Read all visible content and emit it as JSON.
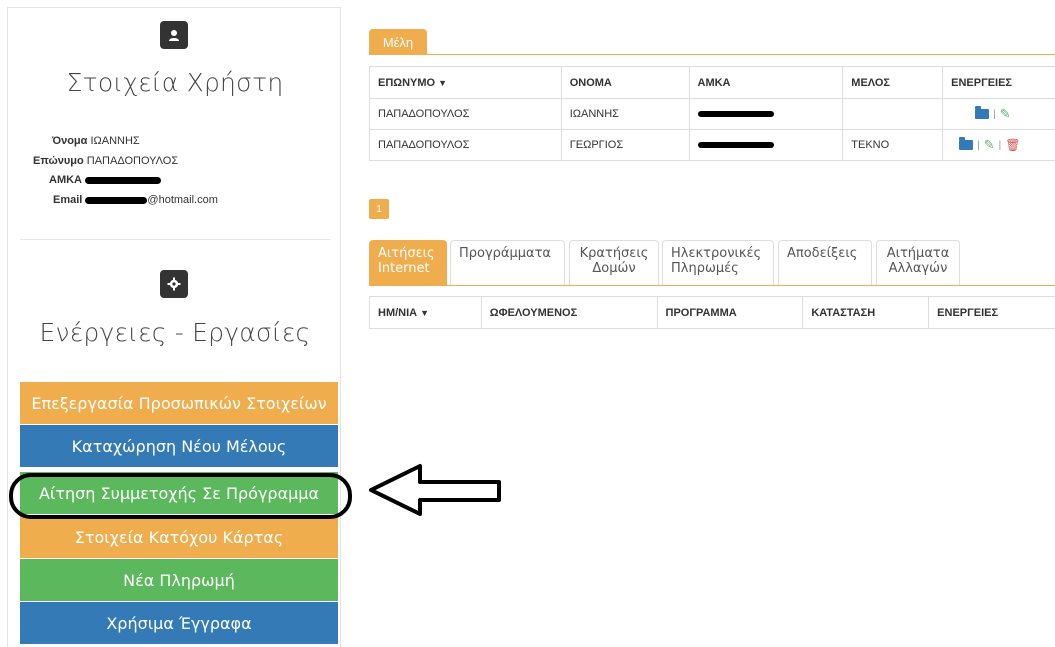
{
  "user_panel": {
    "title": "Στοιχεία Χρήστη",
    "name_label": "Όνομα",
    "name_value": "ΙΩΑΝΝΗΣ",
    "surname_label": "Επώνυμο",
    "surname_value": "ΠΑΠΑΔΟΠΟΥΛΟΣ",
    "amka_label": "ΑΜΚΑ",
    "email_label": "Email",
    "email_suffix": "@hotmail.com"
  },
  "actions_panel": {
    "title": "Ενέργειες - Εργασίες",
    "buttons": [
      {
        "label": "Επεξεργασία Προσωπικών Στοιχείων",
        "color": "#f0ad4e"
      },
      {
        "label": "Καταχώρηση Νέου Μέλους",
        "color": "#337ab7"
      },
      {
        "label": "Αίτηση Συμμετοχής Σε Πρόγραμμα",
        "color": "#5cb85c"
      },
      {
        "label": "Στοιχεία Κατόχου Κάρτας",
        "color": "#f0ad4e"
      },
      {
        "label": "Νέα Πληρωμή",
        "color": "#5cb85c"
      },
      {
        "label": "Χρήσιμα Έγγραφα",
        "color": "#337ab7"
      }
    ]
  },
  "members": {
    "tab_label": "Μέλη",
    "columns": [
      "ΕΠΩΝΥΜΟ",
      "ΟΝΟΜΑ",
      "ΑΜΚΑ",
      "ΜΕΛΟΣ",
      "ΕΝΕΡΓΕΙΕΣ"
    ],
    "rows": [
      {
        "surname": "ΠΑΠΑΔΟΠΟΥΛΟΣ",
        "name": "ΙΩΑΝΝΗΣ",
        "member": ""
      },
      {
        "surname": "ΠΑΠΑΔΟΠΟΥΛΟΣ",
        "name": "ΓΕΩΡΓΙΟΣ",
        "member": "ΤΕΚΝΟ"
      }
    ],
    "page": "1"
  },
  "requests": {
    "tabs": [
      {
        "line1": "Αιτήσεις",
        "line2": "Internet"
      },
      {
        "line1": "Προγράμματα",
        "line2": ""
      },
      {
        "line1": "Κρατήσεις",
        "line2": "Δομών"
      },
      {
        "line1": "Ηλεκτρονικές",
        "line2": "Πληρωμές"
      },
      {
        "line1": "Αποδείξεις",
        "line2": ""
      },
      {
        "line1": "Αιτήματα",
        "line2": "Αλλαγών"
      }
    ],
    "columns": [
      "ΗΜ/ΝΙΑ",
      "ΩΦΕΛΟΥΜΕΝΟΣ",
      "ΠΡΟΓΡΑΜΜΑ",
      "ΚΑΤΑΣΤΑΣΗ",
      "ΕΝΕΡΓΕΙΕΣ"
    ]
  },
  "icons": {
    "user": "user-icon",
    "actions": "gear-icon",
    "folder": "folder-icon",
    "edit": "pencil-icon",
    "delete": "trash-icon"
  }
}
